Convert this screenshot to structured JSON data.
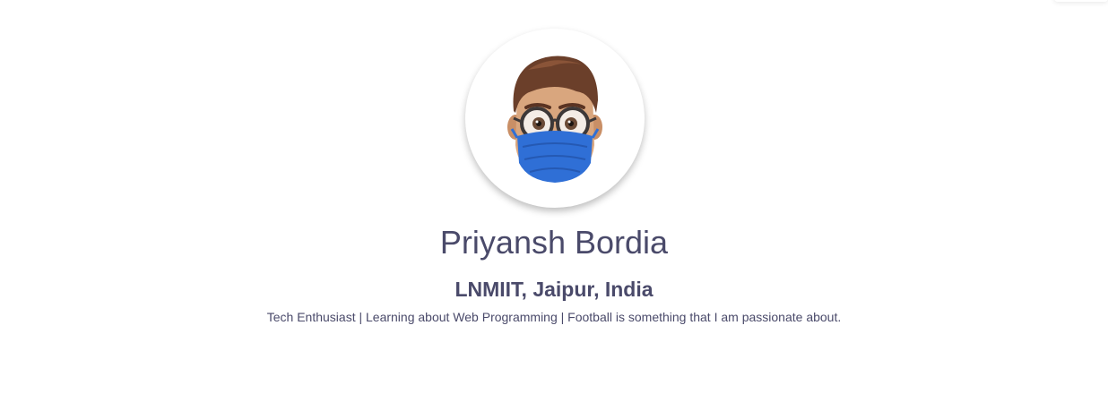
{
  "profile": {
    "name": "Priyansh Bordia",
    "location": "LNMIIT, Jaipur, India",
    "bio": "Tech Enthusiast | Learning about Web Programming | Football is something that I am passionate about.",
    "avatar_icon": "memoji-avatar-icon"
  },
  "colors": {
    "text": "#4a4a6a",
    "mask": "#2f6fd6",
    "hair": "#6b3f2a",
    "skin": "#d9a67e",
    "background": "#ffffff"
  }
}
